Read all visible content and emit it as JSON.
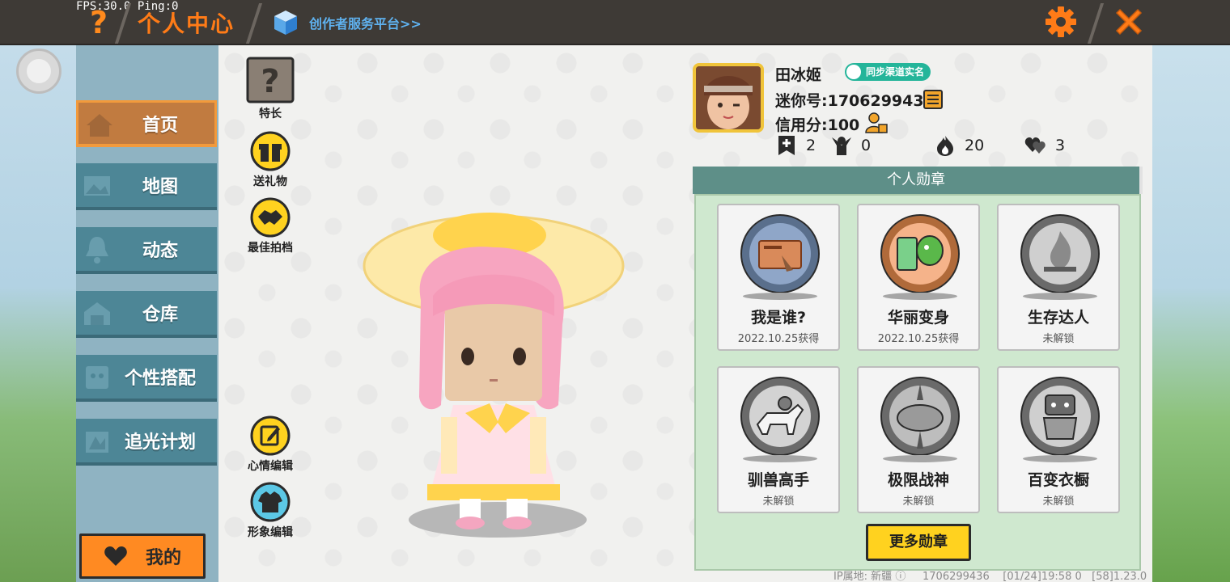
{
  "hud": {
    "fps_ping": "FPS:30.0  Ping:0"
  },
  "header": {
    "help": "?",
    "title": "个人中心",
    "creator_link": "创作者服务平台>>",
    "accent": "#ff7b17"
  },
  "sidebar": {
    "items": [
      {
        "label": "首页",
        "icon": "house-icon",
        "active": true
      },
      {
        "label": "地图",
        "icon": "image-icon"
      },
      {
        "label": "动态",
        "icon": "bell-icon"
      },
      {
        "label": "仓库",
        "icon": "warehouse-icon"
      },
      {
        "label": "个性搭配",
        "icon": "outfit-icon"
      },
      {
        "label": "追光计划",
        "icon": "spotlight-icon"
      }
    ],
    "mine_label": "我的"
  },
  "actions": {
    "specialty": "特长",
    "send_gift": "送礼物",
    "best_partner": "最佳拍档",
    "mood_edit": "心情编辑",
    "look_edit": "形象编辑"
  },
  "profile": {
    "name": "田冰姬",
    "realname_badge": "同步渠道实名",
    "mini_id": "迷你号:1706299436",
    "credit": "信用分:100",
    "stats": [
      {
        "icon": "bookmark-plus-icon",
        "value": "2"
      },
      {
        "icon": "fans-icon",
        "value": "0"
      },
      {
        "icon": "flame-icon",
        "value": "20"
      },
      {
        "icon": "hearts-icon",
        "value": "3"
      }
    ]
  },
  "medals": {
    "title": "个人勋章",
    "items": [
      {
        "name": "我是谁?",
        "sub": "2022.10.25获得",
        "unlocked": true
      },
      {
        "name": "华丽变身",
        "sub": "2022.10.25获得",
        "unlocked": true
      },
      {
        "name": "生存达人",
        "sub": "未解锁",
        "unlocked": false
      },
      {
        "name": "驯兽高手",
        "sub": "未解锁",
        "unlocked": false
      },
      {
        "name": "极限战神",
        "sub": "未解锁",
        "unlocked": false
      },
      {
        "name": "百变衣橱",
        "sub": "未解锁",
        "unlocked": false
      }
    ],
    "more_label": "更多勋章"
  },
  "footer": {
    "ip_region": "IP属地: 新疆",
    "uid": "1706299436",
    "timestamp": "[01/24]19:58 0",
    "version": "[58]1.23.0"
  }
}
